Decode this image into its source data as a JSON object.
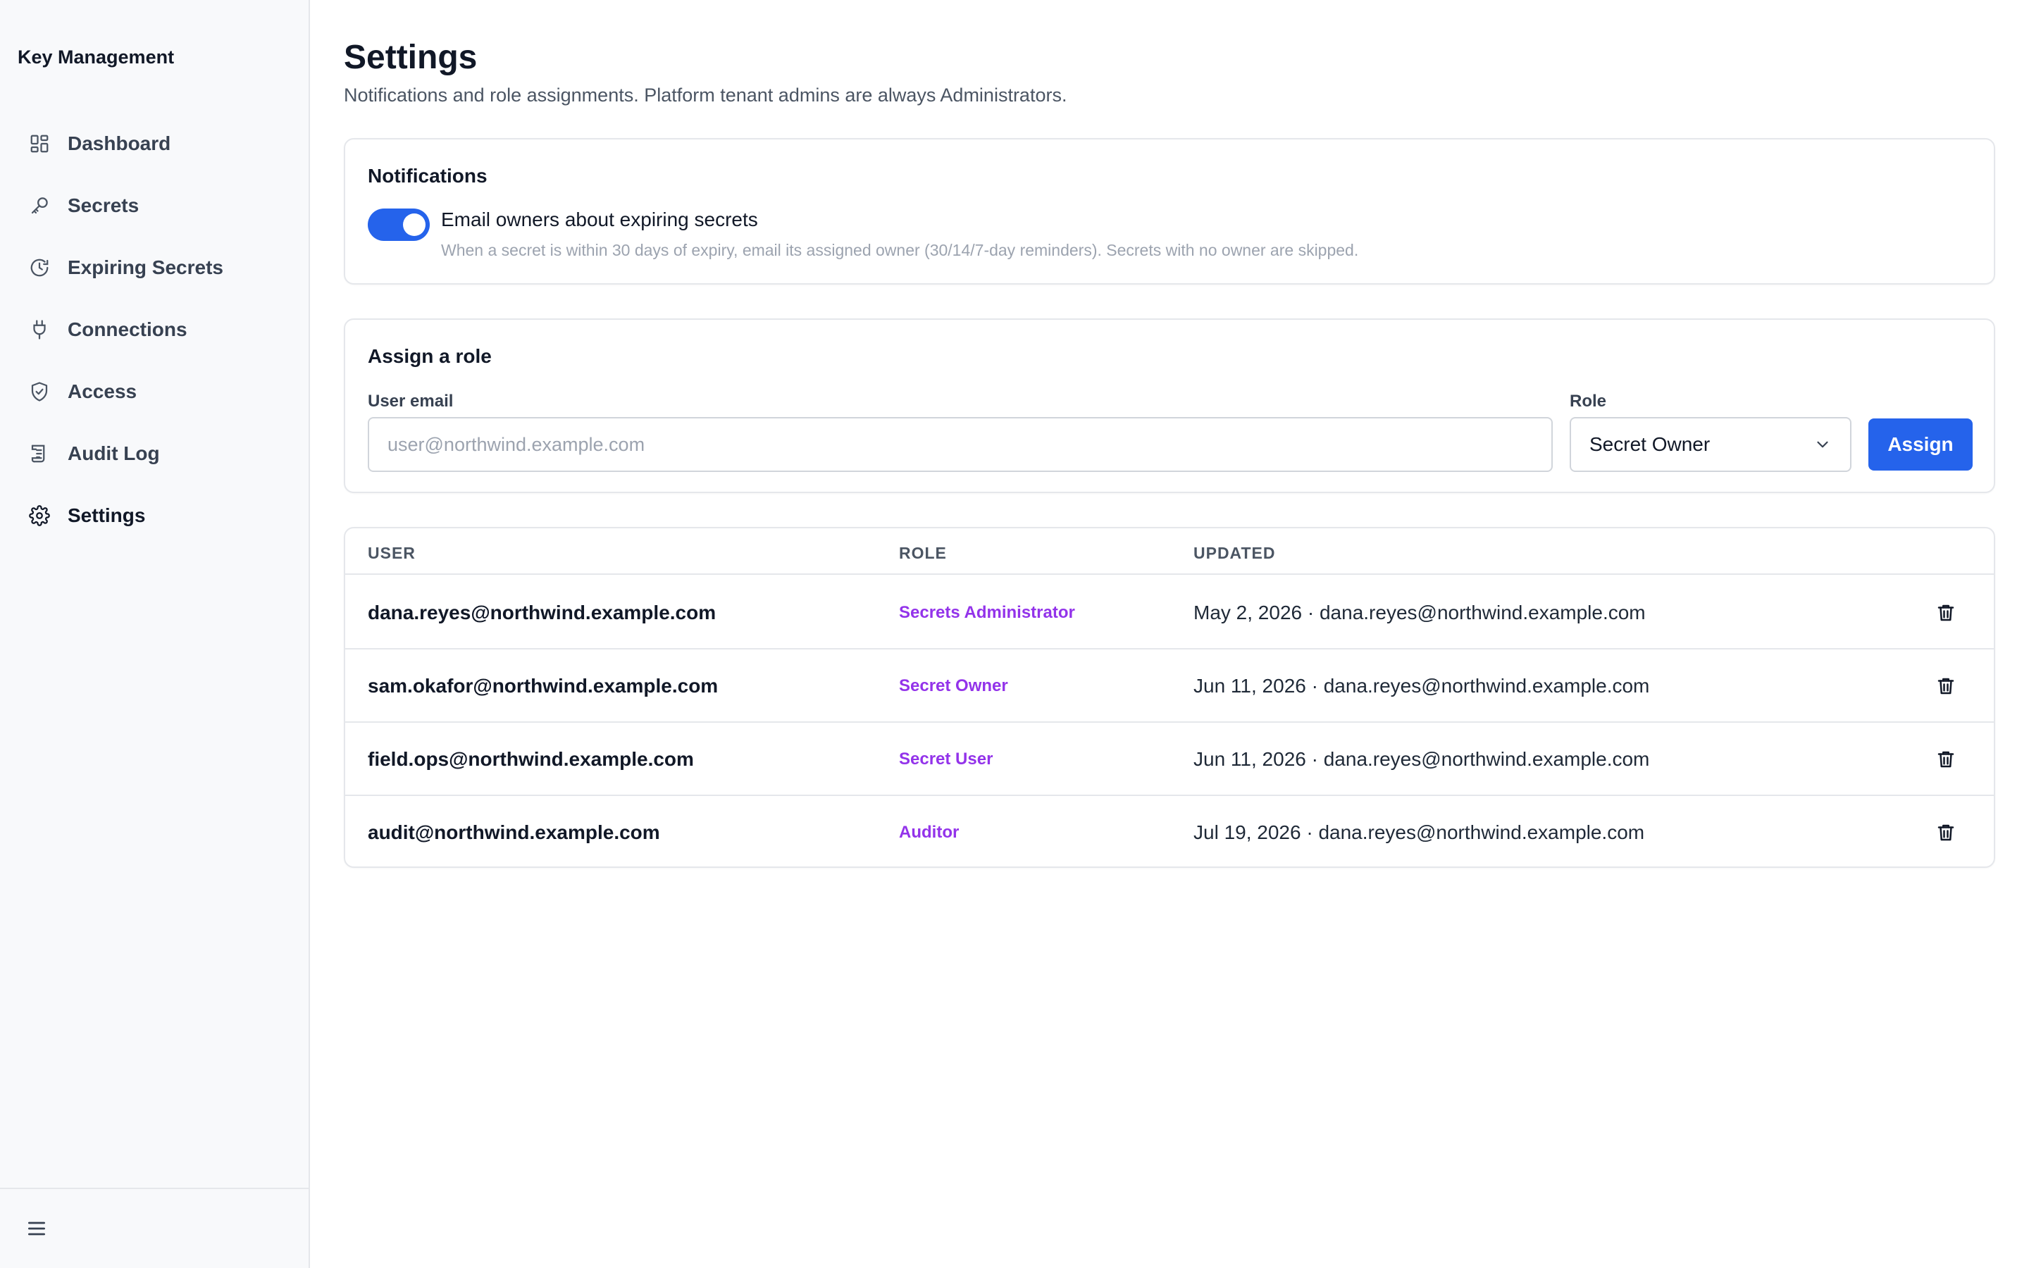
{
  "app": {
    "title": "Key Management"
  },
  "sidebar": {
    "items": [
      {
        "label": "Dashboard",
        "icon": "dashboard-icon"
      },
      {
        "label": "Secrets",
        "icon": "key-icon"
      },
      {
        "label": "Expiring Secrets",
        "icon": "clock-icon"
      },
      {
        "label": "Connections",
        "icon": "plug-icon"
      },
      {
        "label": "Access",
        "icon": "shield-icon"
      },
      {
        "label": "Audit Log",
        "icon": "log-icon"
      },
      {
        "label": "Settings",
        "icon": "gear-icon",
        "active": true
      }
    ],
    "footer_icon": "menu-icon"
  },
  "page": {
    "title": "Settings",
    "subtitle": "Notifications and role assignments. Platform tenant admins are always Administrators."
  },
  "notifications": {
    "title": "Notifications",
    "toggle_on": true,
    "toggle_label": "Email owners about expiring secrets",
    "toggle_help": "When a secret is within 30 days of expiry, email its assigned owner (30/14/7-day reminders). Secrets with no owner are skipped."
  },
  "assign": {
    "title": "Assign a role",
    "email_label": "User email",
    "email_placeholder": "user@northwind.example.com",
    "email_value": "",
    "role_label": "Role",
    "role_value": "Secret Owner",
    "button_label": "Assign"
  },
  "table": {
    "headers": {
      "user": "USER",
      "role": "ROLE",
      "updated": "UPDATED"
    },
    "rows": [
      {
        "user": "dana.reyes@northwind.example.com",
        "role": "Secrets Administrator",
        "updated": "May 2, 2026 · dana.reyes@northwind.example.com"
      },
      {
        "user": "sam.okafor@northwind.example.com",
        "role": "Secret Owner",
        "updated": "Jun 11, 2026 · dana.reyes@northwind.example.com"
      },
      {
        "user": "field.ops@northwind.example.com",
        "role": "Secret User",
        "updated": "Jun 11, 2026 · dana.reyes@northwind.example.com"
      },
      {
        "user": "audit@northwind.example.com",
        "role": "Auditor",
        "updated": "Jul 19, 2026 · dana.reyes@northwind.example.com"
      }
    ]
  },
  "colors": {
    "accent": "#2563eb",
    "role_text": "#9333ea",
    "sidebar_bg": "#f8f9fb",
    "border": "#e5e7eb"
  }
}
